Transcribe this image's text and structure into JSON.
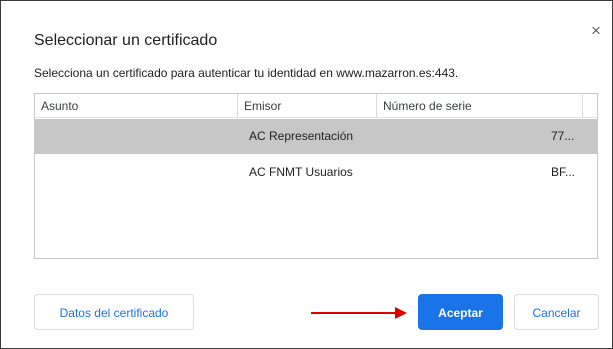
{
  "dialog": {
    "title": "Seleccionar un certificado",
    "close_glyph": "×",
    "subtitle": "Selecciona un certificado para autenticar tu identidad en www.mazarron.es:443."
  },
  "table": {
    "columns": [
      "Asunto",
      "Emisor",
      "Número de serie"
    ],
    "rows": [
      {
        "subject": "",
        "issuer": "AC Representación",
        "serial": "77...",
        "selected": true
      },
      {
        "subject": "",
        "issuer": "AC FNMT Usuarios",
        "serial": "BF...",
        "selected": false
      }
    ]
  },
  "buttons": {
    "details": "Datos del certificado",
    "accept": "Aceptar",
    "cancel": "Cancelar"
  },
  "colors": {
    "primary": "#1a73e8",
    "selected_row": "#c7c7c7",
    "annotation_arrow": "#e00000"
  },
  "icons": {
    "close": "close-icon",
    "annotation": "red-arrow-icon"
  }
}
